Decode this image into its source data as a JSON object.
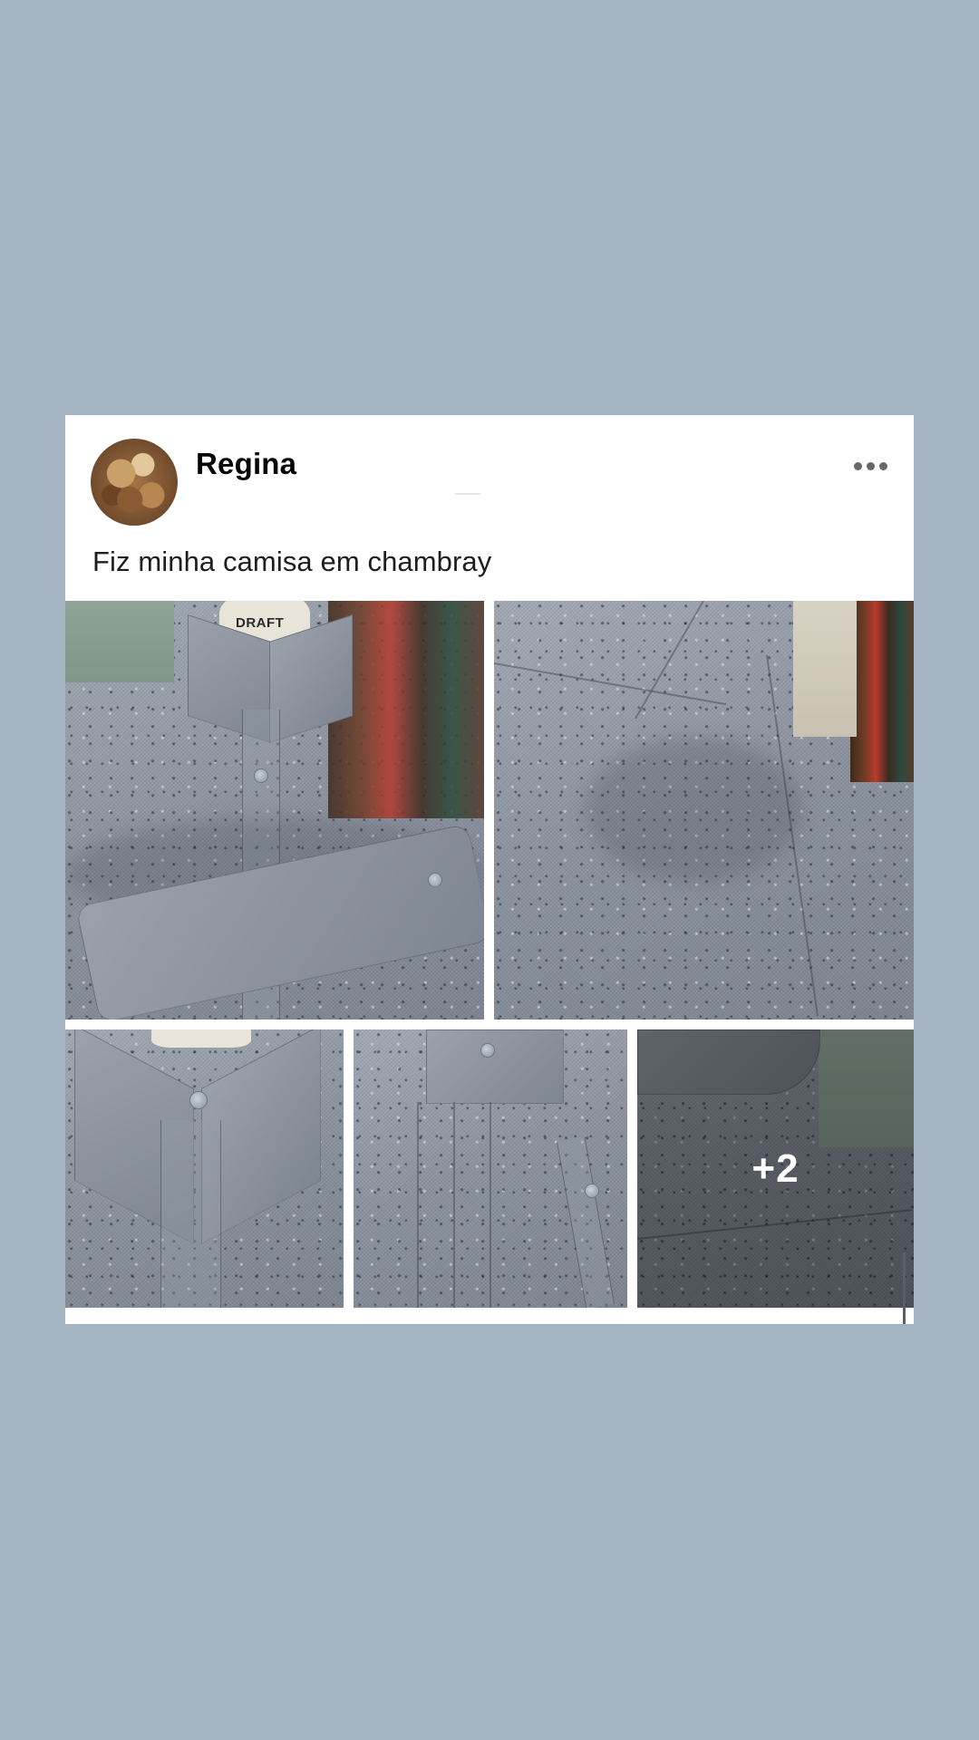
{
  "post": {
    "author": "Regina",
    "caption": "Fiz minha camisa em chambray",
    "avatar_icon": "profile-photo",
    "more_icon": "more-options-icon"
  },
  "photos": {
    "count": 5,
    "more_label": "+2",
    "mannequin_brand": "DRAFT"
  },
  "colors": {
    "background": "#a4b4c3",
    "card": "#ffffff",
    "text": "#1c1e21",
    "fabric": "#8e96a2"
  }
}
